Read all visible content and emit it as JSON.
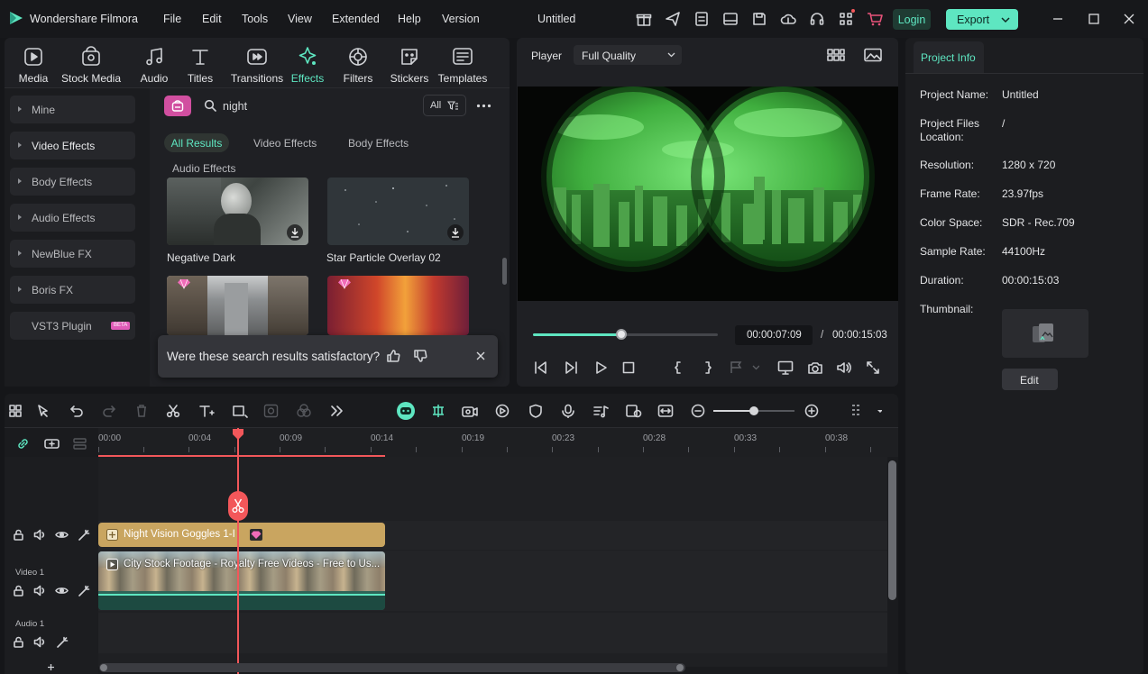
{
  "app": {
    "name": "Wondershare Filmora",
    "project_title": "Untitled"
  },
  "menu": [
    "File",
    "Edit",
    "Tools",
    "View",
    "Extended",
    "Help",
    "Version"
  ],
  "top_actions": {
    "login": "Login",
    "export": "Export"
  },
  "media_tabs": [
    {
      "label": "Media",
      "icon": "media-icon"
    },
    {
      "label": "Stock Media",
      "icon": "stock-media-icon"
    },
    {
      "label": "Audio",
      "icon": "audio-icon"
    },
    {
      "label": "Titles",
      "icon": "titles-icon"
    },
    {
      "label": "Transitions",
      "icon": "transitions-icon"
    },
    {
      "label": "Effects",
      "icon": "effects-icon",
      "active": true
    },
    {
      "label": "Filters",
      "icon": "filters-icon"
    },
    {
      "label": "Stickers",
      "icon": "stickers-icon"
    },
    {
      "label": "Templates",
      "icon": "templates-icon"
    }
  ],
  "sidebar": [
    "Mine",
    "Video Effects",
    "Body Effects",
    "Audio Effects",
    "NewBlue FX",
    "Boris FX",
    "VST3 Plugin"
  ],
  "sidebar_badge": "BETA",
  "search": {
    "value": "night",
    "filter_label": "All"
  },
  "result_tabs": [
    "All Results",
    "Video Effects",
    "Body Effects",
    "Audio Effects"
  ],
  "results": [
    {
      "label": "Negative Dark"
    },
    {
      "label": "Star Particle Overlay 02"
    }
  ],
  "feedback": {
    "question": "Were these search results satisfactory?"
  },
  "player": {
    "label": "Player",
    "quality": "Full Quality",
    "current_time": "00:00:07:09",
    "separator": "/",
    "total_time": "00:00:15:03",
    "progress": 0.48
  },
  "project_info": {
    "tab": "Project Info",
    "rows": [
      {
        "key": "Project Name:",
        "value": "Untitled"
      },
      {
        "key": "Project Files Location:",
        "value": "/"
      },
      {
        "key": "Resolution:",
        "value": "1280 x 720"
      },
      {
        "key": "Frame Rate:",
        "value": "23.97fps"
      },
      {
        "key": "Color Space:",
        "value": "SDR - Rec.709"
      },
      {
        "key": "Sample Rate:",
        "value": "44100Hz"
      },
      {
        "key": "Duration:",
        "value": "00:00:15:03"
      },
      {
        "key": "Thumbnail:",
        "value": ""
      }
    ],
    "edit_label": "Edit"
  },
  "timeline": {
    "ruler": [
      "00:00",
      "00:04",
      "00:09",
      "00:14",
      "00:19",
      "00:23",
      "00:28",
      "00:33",
      "00:38"
    ],
    "effect_clip": "Night Vision Goggles 1-I",
    "video_clip": "City Stock Footage - Royalty Free Videos - Free to Us...",
    "tracks": [
      "Video 1",
      "Audio 1"
    ],
    "zoom_level": 0.5
  },
  "colors": {
    "accent": "#5ee6c1",
    "playhead": "#f2575a",
    "effect_clip": "#c9a560",
    "video_clip": "#2d6458"
  }
}
